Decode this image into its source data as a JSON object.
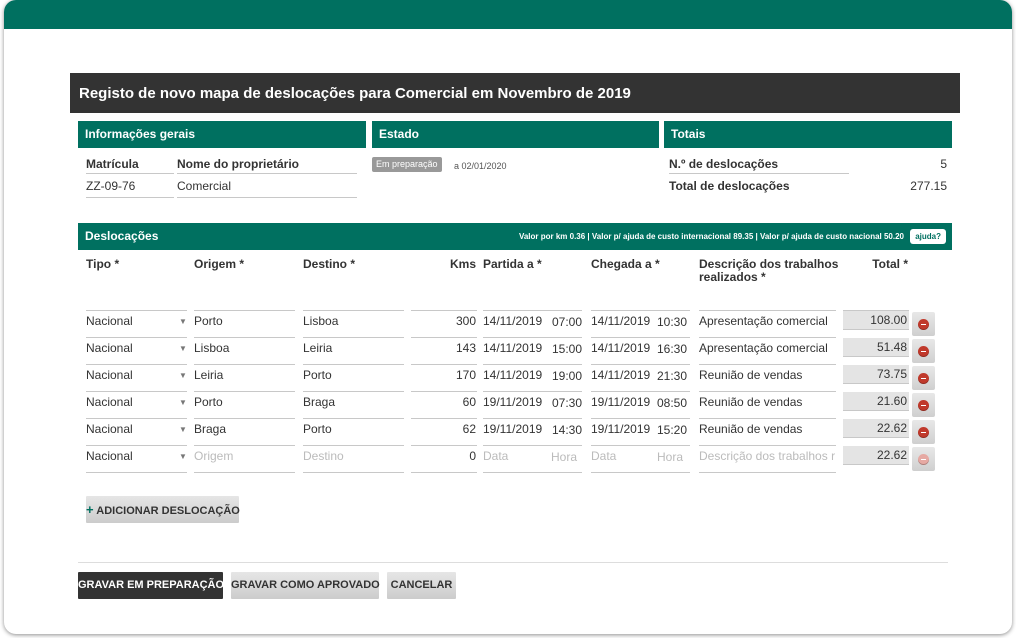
{
  "title": "Registo de novo mapa de deslocações para Comercial em Novembro de 2019",
  "sections": {
    "info": "Informações gerais",
    "estado": "Estado",
    "totais": "Totais"
  },
  "info": {
    "matricula_label": "Matrícula",
    "matricula_value": "ZZ-09-76",
    "owner_label": "Nome do proprietário",
    "owner_value": "Comercial"
  },
  "estado": {
    "badge": "Em preparação",
    "date": "a 02/01/2020"
  },
  "totais": {
    "n_label": "N.º de deslocações",
    "n_value": "5",
    "total_label": "Total de deslocações",
    "total_value": "277.15"
  },
  "deslocacoes": {
    "title": "Deslocações",
    "rates": "Valor por km 0.36  |  Valor p/ ajuda de custo internacional 89.35  |  Valor p/ ajuda de custo nacional 50.20",
    "help": "ajuda?",
    "columns": {
      "tipo": "Tipo *",
      "origem": "Origem *",
      "destino": "Destino *",
      "kms": "Kms",
      "partida": "Partida a *",
      "chegada": "Chegada a *",
      "descricao": "Descrição dos trabalhos realizados *",
      "total": "Total *"
    },
    "rows": [
      {
        "tipo": "Nacional",
        "origem": "Porto",
        "destino": "Lisboa",
        "kms": "300",
        "pdata": "14/11/2019",
        "phora": "07:00",
        "cdata": "14/11/2019",
        "chora": "10:30",
        "desc": "Apresentação comercial",
        "total": "108.00"
      },
      {
        "tipo": "Nacional",
        "origem": "Lisboa",
        "destino": "Leiria",
        "kms": "143",
        "pdata": "14/11/2019",
        "phora": "15:00",
        "cdata": "14/11/2019",
        "chora": "16:30",
        "desc": "Apresentação comercial",
        "total": "51.48"
      },
      {
        "tipo": "Nacional",
        "origem": "Leiria",
        "destino": "Porto",
        "kms": "170",
        "pdata": "14/11/2019",
        "phora": "19:00",
        "cdata": "14/11/2019",
        "chora": "21:30",
        "desc": "Reunião de vendas",
        "total": "73.75"
      },
      {
        "tipo": "Nacional",
        "origem": "Porto",
        "destino": "Braga",
        "kms": "60",
        "pdata": "19/11/2019",
        "phora": "07:30",
        "cdata": "19/11/2019",
        "chora": "08:50",
        "desc": "Reunião de vendas",
        "total": "21.60"
      },
      {
        "tipo": "Nacional",
        "origem": "Braga",
        "destino": "Porto",
        "kms": "62",
        "pdata": "19/11/2019",
        "phora": "14:30",
        "cdata": "19/11/2019",
        "chora": "15:20",
        "desc": "Reunião de vendas",
        "total": "22.62"
      }
    ],
    "new_row": {
      "tipo": "Nacional",
      "origem_ph": "Origem",
      "destino_ph": "Destino",
      "kms": "0",
      "data_ph": "Data",
      "hora_ph": "Hora",
      "desc_ph": "Descrição dos trabalhos r",
      "total": "22.62"
    },
    "add_label": "ADICIONAR DESLOCAÇÃO"
  },
  "actions": {
    "save_prep": "GRAVAR EM PREPARAÇÃO",
    "save_approved": "GRAVAR COMO APROVADO",
    "cancel": "CANCELAR"
  },
  "colors": {
    "brand": "#007060",
    "dark": "#333333",
    "danger": "#c0392b"
  },
  "icons": {
    "delete": "remove-circle-icon",
    "add": "plus-icon",
    "select": "caret-down-icon"
  }
}
